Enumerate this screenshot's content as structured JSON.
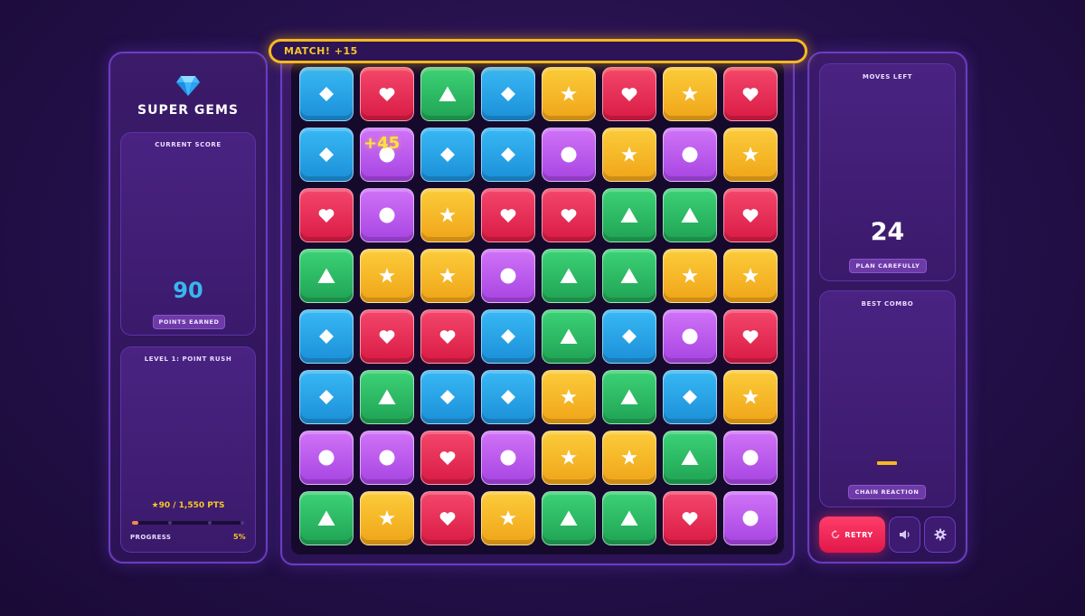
{
  "game": {
    "title": "SUPER GEMS",
    "banner": "MATCH! +15",
    "floating_points": "+45"
  },
  "score": {
    "label": "CURRENT SCORE",
    "value": "90",
    "pill": "POINTS EARNED"
  },
  "level": {
    "label": "LEVEL 1: POINT RUSH",
    "points_text": "★90 / 1,550 PTS",
    "progress_label": "PROGRESS",
    "progress_percent_text": "5%",
    "progress_fraction": 0.058
  },
  "moves": {
    "label": "MOVES LEFT",
    "value": "24",
    "pill": "PLAN CAREFULLY"
  },
  "combo": {
    "label": "BEST COMBO",
    "value": "–",
    "pill": "CHAIN REACTION"
  },
  "controls": {
    "retry_label": "RETRY",
    "sound_icon": "speaker-icon",
    "settings_icon": "gear-icon"
  },
  "colors": {
    "blue": "#2aa5e8",
    "red": "#e8305a",
    "green": "#2ebd63",
    "yellow": "#f6b928",
    "purple": "#bf5cef",
    "accent": "#f7b81f"
  },
  "board": {
    "rows": [
      [
        "blue-diamond",
        "red-heart",
        "green-triangle",
        "blue-diamond",
        "yellow-star",
        "red-heart",
        "yellow-star",
        "red-heart"
      ],
      [
        "blue-diamond",
        "purple-circle",
        "blue-diamond",
        "blue-diamond",
        "purple-circle",
        "yellow-star",
        "purple-circle",
        "yellow-star"
      ],
      [
        "red-heart",
        "purple-circle",
        "yellow-star",
        "red-heart",
        "red-heart",
        "green-triangle",
        "green-triangle",
        "red-heart"
      ],
      [
        "green-triangle",
        "yellow-star",
        "yellow-star",
        "purple-circle",
        "green-triangle",
        "green-triangle",
        "yellow-star",
        "yellow-star"
      ],
      [
        "blue-diamond",
        "red-heart",
        "red-heart",
        "blue-diamond",
        "green-triangle",
        "blue-diamond",
        "purple-circle",
        "red-heart"
      ],
      [
        "blue-diamond",
        "green-triangle",
        "blue-diamond",
        "blue-diamond",
        "yellow-star",
        "green-triangle",
        "blue-diamond",
        "yellow-star"
      ],
      [
        "purple-circle",
        "purple-circle",
        "red-heart",
        "purple-circle",
        "yellow-star",
        "yellow-star",
        "green-triangle",
        "purple-circle"
      ],
      [
        "green-triangle",
        "yellow-star",
        "red-heart",
        "yellow-star",
        "green-triangle",
        "green-triangle",
        "red-heart",
        "purple-circle"
      ]
    ]
  }
}
